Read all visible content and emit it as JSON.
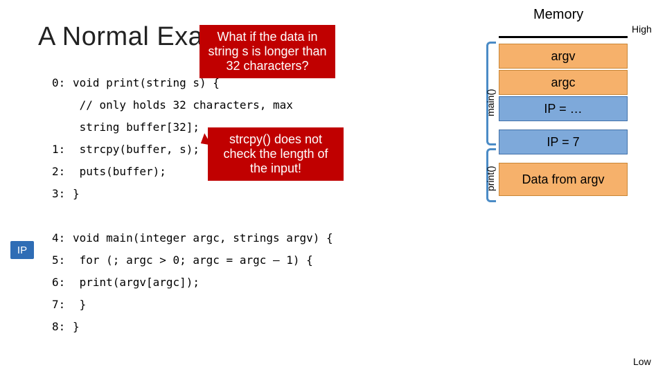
{
  "title": "A Normal Exampl",
  "ip_badge": "IP",
  "callouts": {
    "top": "What if the data in string s is longer than 32 characters?",
    "mid": "strcpy() does not check the length of the input!"
  },
  "code": {
    "lines": [
      {
        "n": "0:",
        "t": "void print(string s) {"
      },
      {
        "n": "",
        "t": "    // only holds 32 characters, max"
      },
      {
        "n": "",
        "t": "    string buffer[32];"
      },
      {
        "n": "1:",
        "t": "    strcpy(buffer, s);"
      },
      {
        "n": "2:",
        "t": "    puts(buffer);"
      },
      {
        "n": "3:",
        "t": "}"
      },
      {
        "n": "",
        "t": ""
      },
      {
        "n": "4:",
        "t": "void main(integer argc, strings argv) {"
      },
      {
        "n": "5:",
        "t": "  for (; argc > 0; argc = argc – 1) {"
      },
      {
        "n": "6:",
        "t": "    print(argv[argc]);"
      },
      {
        "n": "7:",
        "t": "  }"
      },
      {
        "n": "8:",
        "t": "}"
      }
    ]
  },
  "memory": {
    "title": "Memory",
    "high": "High",
    "low": "Low",
    "brackets": {
      "main": "main()",
      "print": "print()"
    },
    "cells": [
      {
        "label": "argv",
        "cls": "orange",
        "gap_before": 8
      },
      {
        "label": "argc",
        "cls": "orange",
        "gap_before": 2
      },
      {
        "label": "IP = …",
        "cls": "blue",
        "gap_before": 2
      },
      {
        "label": "IP = 7",
        "cls": "blue",
        "gap_before": 12
      },
      {
        "label": "Data from argv",
        "cls": "orange",
        "gap_before": 12,
        "h": 48
      }
    ]
  }
}
